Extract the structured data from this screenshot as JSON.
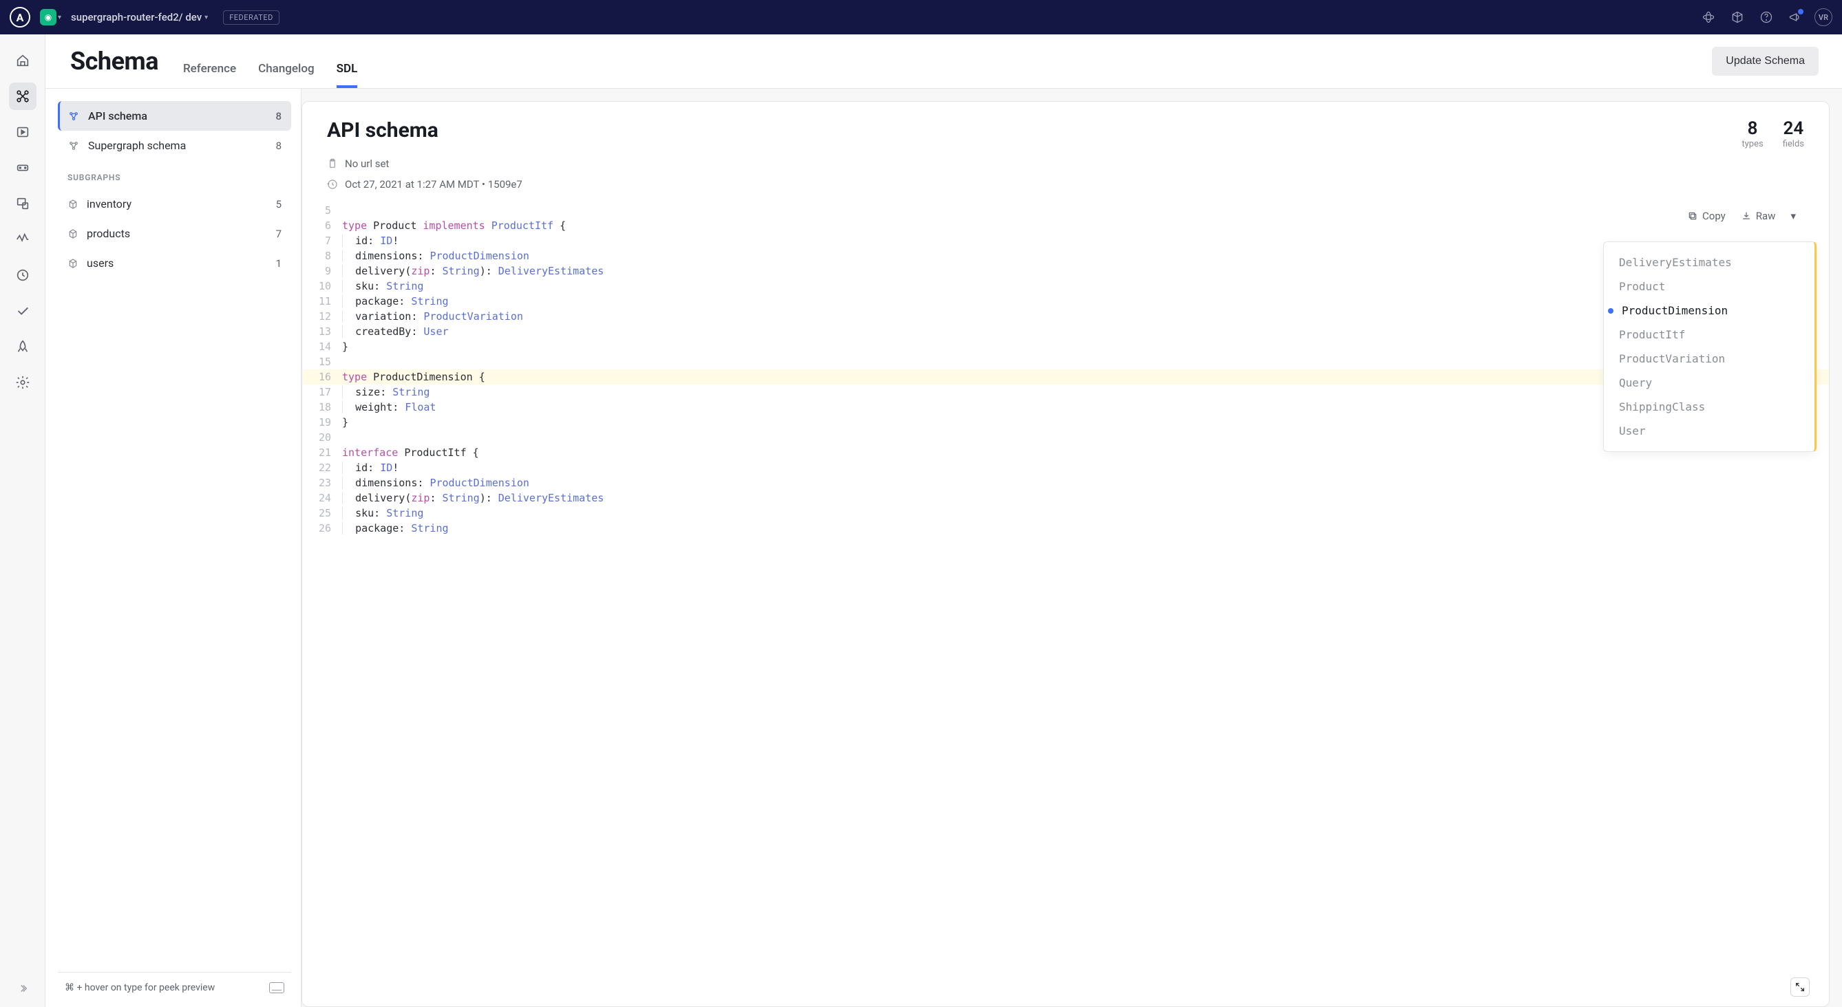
{
  "topbar": {
    "logo_letter": "A",
    "breadcrumb": "supergraph-router-fed2/ dev",
    "badge": "FEDERATED",
    "avatar_initials": "VR"
  },
  "page": {
    "title": "Schema",
    "tabs": [
      "Reference",
      "Changelog",
      "SDL"
    ],
    "active_tab": 2,
    "update_button": "Update Schema"
  },
  "sidepanel": {
    "schemas": [
      {
        "label": "API schema",
        "count": "8",
        "active": true
      },
      {
        "label": "Supergraph schema",
        "count": "8",
        "active": false
      }
    ],
    "subgraphs_heading": "SUBGRAPHS",
    "subgraphs": [
      {
        "label": "inventory",
        "count": "5"
      },
      {
        "label": "products",
        "count": "7"
      },
      {
        "label": "users",
        "count": "1"
      }
    ],
    "footer_hint": "⌘ + hover on type for peek preview"
  },
  "card": {
    "title": "API schema",
    "stats": [
      {
        "num": "8",
        "lbl": "types"
      },
      {
        "num": "24",
        "lbl": "fields"
      }
    ],
    "url_text": "No url set",
    "timestamp": "Oct 27, 2021 at 1:27 AM MDT • 1509e7"
  },
  "toolbar": {
    "copy": "Copy",
    "raw": "Raw"
  },
  "outline": {
    "items": [
      "DeliveryEstimates",
      "Product",
      "ProductDimension",
      "ProductItf",
      "ProductVariation",
      "Query",
      "ShippingClass",
      "User"
    ],
    "active_index": 2
  },
  "code_lines": [
    {
      "n": 5,
      "html": ""
    },
    {
      "n": 6,
      "html": "<span class='kw'>type</span> <span class='typename'>Product</span> <span class='kw'>implements</span> <span class='typeref'>ProductItf</span> <span class='punct'>{</span>"
    },
    {
      "n": 7,
      "html": "  <span class='field'>id</span><span class='punct'>:</span> <span class='typeref'>ID</span><span class='punct'>!</span>",
      "guide": true
    },
    {
      "n": 8,
      "html": "  <span class='field'>dimensions</span><span class='punct'>:</span> <span class='typeref'>ProductDimension</span>",
      "guide": true
    },
    {
      "n": 9,
      "html": "  <span class='field'>delivery</span><span class='punct'>(</span><span class='param'>zip</span><span class='punct'>:</span> <span class='typeref'>String</span><span class='punct'>):</span> <span class='typeref'>DeliveryEstimates</span>",
      "guide": true
    },
    {
      "n": 10,
      "html": "  <span class='field'>sku</span><span class='punct'>:</span> <span class='typeref'>String</span>",
      "guide": true
    },
    {
      "n": 11,
      "html": "  <span class='field'>package</span><span class='punct'>:</span> <span class='typeref'>String</span>",
      "guide": true
    },
    {
      "n": 12,
      "html": "  <span class='field'>variation</span><span class='punct'>:</span> <span class='typeref'>ProductVariation</span>",
      "guide": true
    },
    {
      "n": 13,
      "html": "  <span class='field'>createdBy</span><span class='punct'>:</span> <span class='typeref'>User</span>",
      "guide": true,
      "link": true
    },
    {
      "n": 14,
      "html": "<span class='punct'>}</span>"
    },
    {
      "n": 15,
      "html": ""
    },
    {
      "n": 16,
      "html": "<span class='kw'>type</span> <span class='typename'>ProductDimension</span> <span class='punct'>{</span>",
      "hl": true
    },
    {
      "n": 17,
      "html": "  <span class='field'>size</span><span class='punct'>:</span> <span class='typeref'>String</span>",
      "guide": true
    },
    {
      "n": 18,
      "html": "  <span class='field'>weight</span><span class='punct'>:</span> <span class='typeref'>Float</span>",
      "guide": true
    },
    {
      "n": 19,
      "html": "<span class='punct'>}</span>"
    },
    {
      "n": 20,
      "html": ""
    },
    {
      "n": 21,
      "html": "<span class='kw'>interface</span> <span class='typename'>ProductItf</span> <span class='punct'>{</span>"
    },
    {
      "n": 22,
      "html": "  <span class='field'>id</span><span class='punct'>:</span> <span class='typeref'>ID</span><span class='punct'>!</span>",
      "guide": true
    },
    {
      "n": 23,
      "html": "  <span class='field'>dimensions</span><span class='punct'>:</span> <span class='typeref'>ProductDimension</span>",
      "guide": true
    },
    {
      "n": 24,
      "html": "  <span class='field'>delivery</span><span class='punct'>(</span><span class='param'>zip</span><span class='punct'>:</span> <span class='typeref'>String</span><span class='punct'>):</span> <span class='typeref'>DeliveryEstimates</span>",
      "guide": true
    },
    {
      "n": 25,
      "html": "  <span class='field'>sku</span><span class='punct'>:</span> <span class='typeref'>String</span>",
      "guide": true
    },
    {
      "n": 26,
      "html": "  <span class='field'>package</span><span class='punct'>:</span> <span class='typeref'>String</span>",
      "guide": true
    }
  ]
}
